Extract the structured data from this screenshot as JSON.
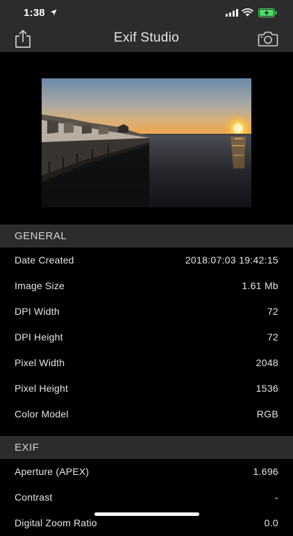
{
  "status_bar": {
    "time": "1:38"
  },
  "nav": {
    "title": "Exif Studio"
  },
  "general": {
    "header": "GENERAL",
    "rows": [
      {
        "label": "Date Created",
        "value": "2018:07:03 19:42:15"
      },
      {
        "label": "Image Size",
        "value": "1.61 Mb"
      },
      {
        "label": "DPI Width",
        "value": "72"
      },
      {
        "label": "DPI Height",
        "value": "72"
      },
      {
        "label": "Pixel Width",
        "value": "2048"
      },
      {
        "label": "Pixel Height",
        "value": "1536"
      },
      {
        "label": "Color Model",
        "value": "RGB"
      }
    ]
  },
  "exif": {
    "header": "EXIF",
    "rows": [
      {
        "label": "Aperture (APEX)",
        "value": "1.696"
      },
      {
        "label": "Contrast",
        "value": "-"
      },
      {
        "label": "Digital Zoom Ratio",
        "value": "0.0"
      }
    ]
  },
  "colors": {
    "bar": "#2c2c2e",
    "background": "#000000",
    "battery": "#4cd964"
  },
  "icons": [
    "location-arrow-icon",
    "signal-icon",
    "wifi-icon",
    "battery-charging-icon",
    "share-icon",
    "camera-icon"
  ]
}
